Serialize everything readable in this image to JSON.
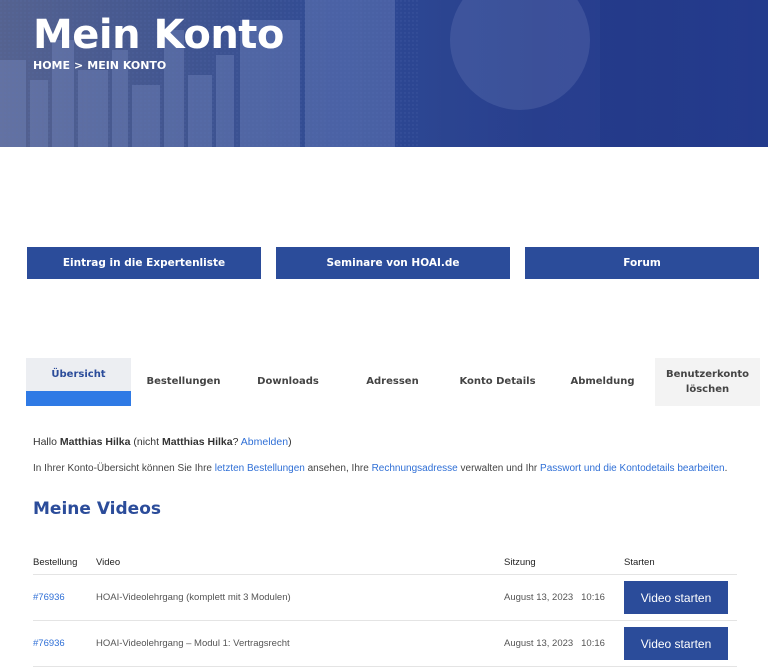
{
  "hero": {
    "title": "Mein Konto",
    "breadcrumb": {
      "home": "HOME",
      "separator": ">",
      "current": "MEIN KONTO"
    }
  },
  "top_buttons": [
    {
      "label": "Eintrag in die Expertenliste"
    },
    {
      "label": "Seminare von HOAI.de"
    },
    {
      "label": "Forum"
    }
  ],
  "tabs": [
    {
      "label": "Übersicht",
      "active": true
    },
    {
      "label": "Bestellungen"
    },
    {
      "label": "Downloads"
    },
    {
      "label": "Adressen"
    },
    {
      "label": "Konto Details"
    },
    {
      "label": "Abmeldung"
    },
    {
      "label_line1": "Benutzerkonto",
      "label_line2": "löschen"
    }
  ],
  "greeting": {
    "hello": "Hallo",
    "name": "Matthias Hilka",
    "not_prefix": "(nicht",
    "not_name": "Matthias Hilka",
    "question": "?",
    "logout_link": "Abmelden",
    "close_paren": ")"
  },
  "overview": {
    "part1": "In Ihrer Konto-Übersicht können Sie Ihre",
    "link_orders": "letzten Bestellungen",
    "part2": "ansehen, Ihre",
    "link_billing": "Rechnungsadresse",
    "part3": "verwalten und Ihr",
    "link_password": "Passwort und die Kontodetails bearbeiten",
    "part4": "."
  },
  "videos": {
    "title": "Meine Videos",
    "headers": {
      "order": "Bestellung",
      "video": "Video",
      "session": "Sitzung",
      "start": "Starten"
    },
    "rows": [
      {
        "order": "#76936",
        "video": "HOAI-Videolehrgang (komplett mit 3 Modulen)",
        "date": "August 13, 2023",
        "time": "10:16",
        "button": "Video starten"
      },
      {
        "order": "#76936",
        "video": "HOAI-Videolehrgang – Modul 1: Vertragsrecht",
        "date": "August 13, 2023",
        "time": "10:16",
        "button": "Video starten"
      }
    ]
  },
  "colors": {
    "brand": "#2b4c9a",
    "accent": "#2f7ae5",
    "link": "#2f6fd6"
  }
}
